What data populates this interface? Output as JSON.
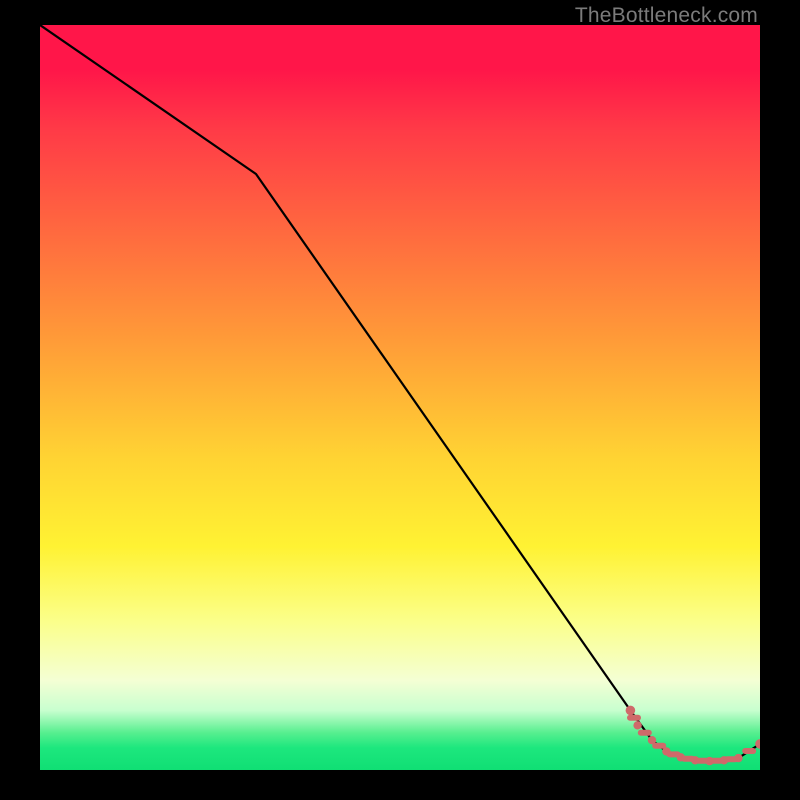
{
  "watermark": {
    "text": "TheBottleneck.com"
  },
  "colors": {
    "background": "#000000",
    "curve": "#000000",
    "marker": "#cf6a6a",
    "watermark": "#7b7b7b"
  },
  "chart_data": {
    "type": "line",
    "title": "",
    "xlabel": "",
    "ylabel": "",
    "xlim": [
      0,
      100
    ],
    "ylim": [
      0,
      100
    ],
    "grid": false,
    "legend": false,
    "x": [
      0,
      30,
      82,
      85,
      87,
      89,
      91,
      93,
      95,
      97,
      100
    ],
    "values": [
      100,
      80,
      8,
      4,
      2.5,
      1.7,
      1.3,
      1.2,
      1.3,
      1.6,
      3.5
    ],
    "markers_x": [
      82,
      83,
      85,
      87,
      89,
      91,
      93,
      95,
      97,
      100
    ],
    "markers_values": [
      8,
      6,
      4,
      2.5,
      1.7,
      1.3,
      1.2,
      1.3,
      1.6,
      3.5
    ]
  }
}
